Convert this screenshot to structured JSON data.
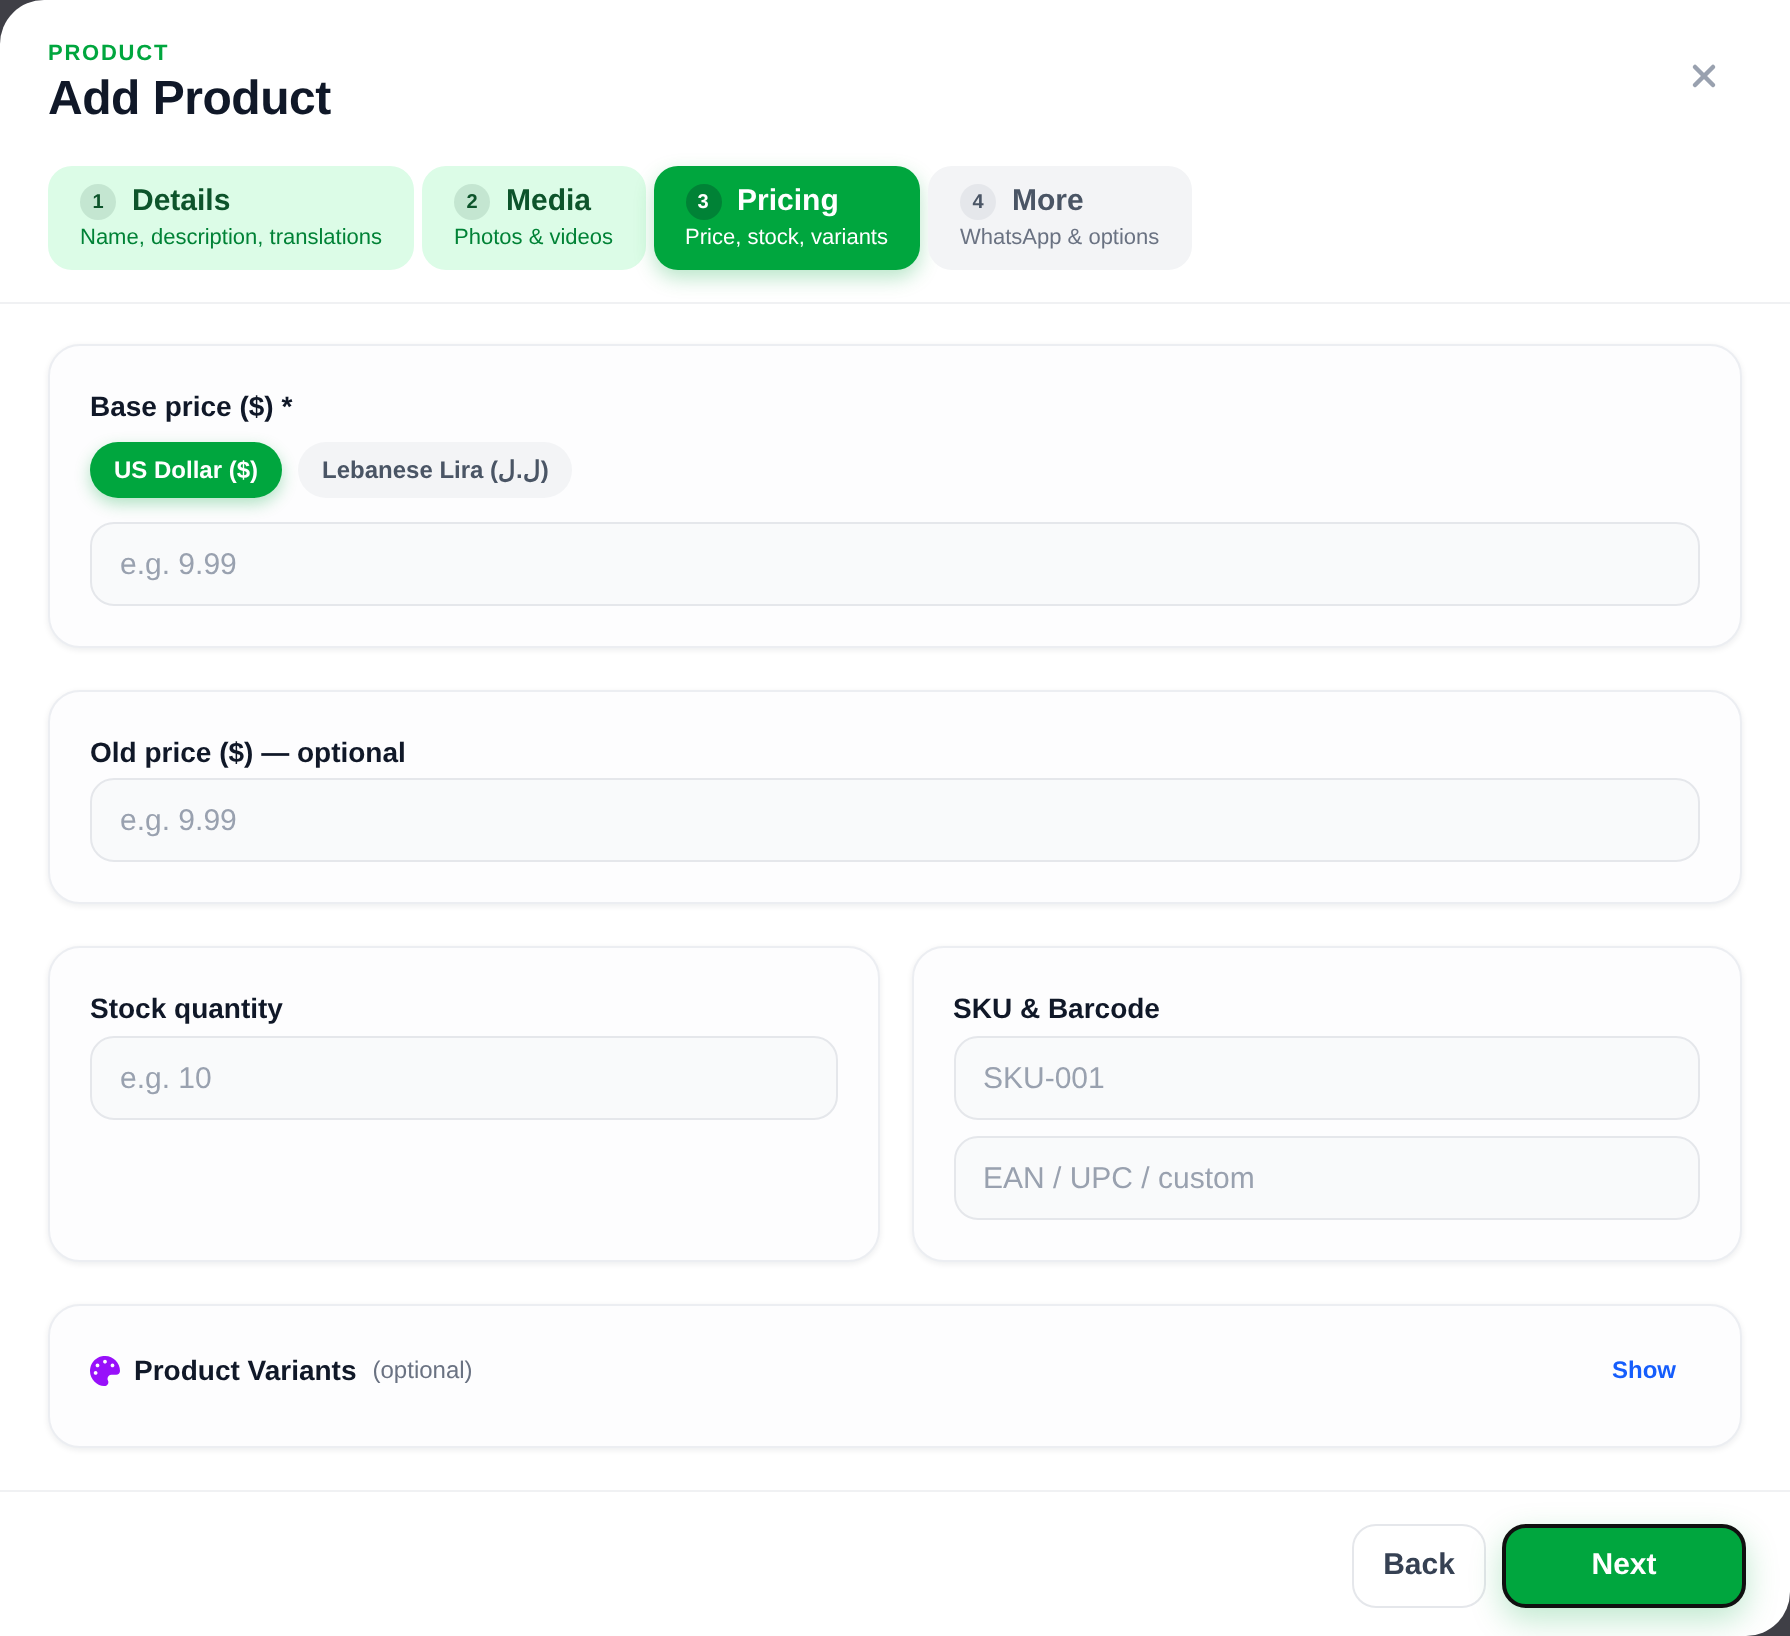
{
  "header": {
    "eyebrow": "PRODUCT",
    "title": "Add Product"
  },
  "steps": [
    {
      "number": "1",
      "label": "Details",
      "hint": "Name, description, translations",
      "completed": true,
      "selected": false
    },
    {
      "number": "2",
      "label": "Media",
      "hint": "Photos & videos",
      "completed": true,
      "selected": false
    },
    {
      "number": "3",
      "label": "Pricing",
      "hint": "Price, stock, variants",
      "completed": false,
      "selected": true
    },
    {
      "number": "4",
      "label": "More",
      "hint": "WhatsApp & options",
      "completed": false,
      "selected": false
    }
  ],
  "base_price": {
    "label": "Base price ($) *",
    "currencies": [
      {
        "label": "US Dollar ($)",
        "selected": true
      },
      {
        "label": "Lebanese Lira (ل.ل)",
        "selected": false
      }
    ],
    "placeholder": "e.g. 9.99"
  },
  "old_price": {
    "label": "Old price ($) — optional",
    "placeholder": "e.g. 9.99"
  },
  "stock": {
    "label": "Stock quantity",
    "placeholder": "e.g. 10"
  },
  "sku": {
    "label": "SKU & Barcode",
    "fields": [
      {
        "placeholder": "SKU-001"
      },
      {
        "placeholder": "EAN / UPC / custom"
      }
    ]
  },
  "variants": {
    "title": "Product Variants",
    "note": "(optional)",
    "action": "Show"
  },
  "footer": {
    "buttons": [
      {
        "label": "Back",
        "kind": "secondary"
      },
      {
        "label": "Next",
        "kind": "primary"
      }
    ]
  }
}
